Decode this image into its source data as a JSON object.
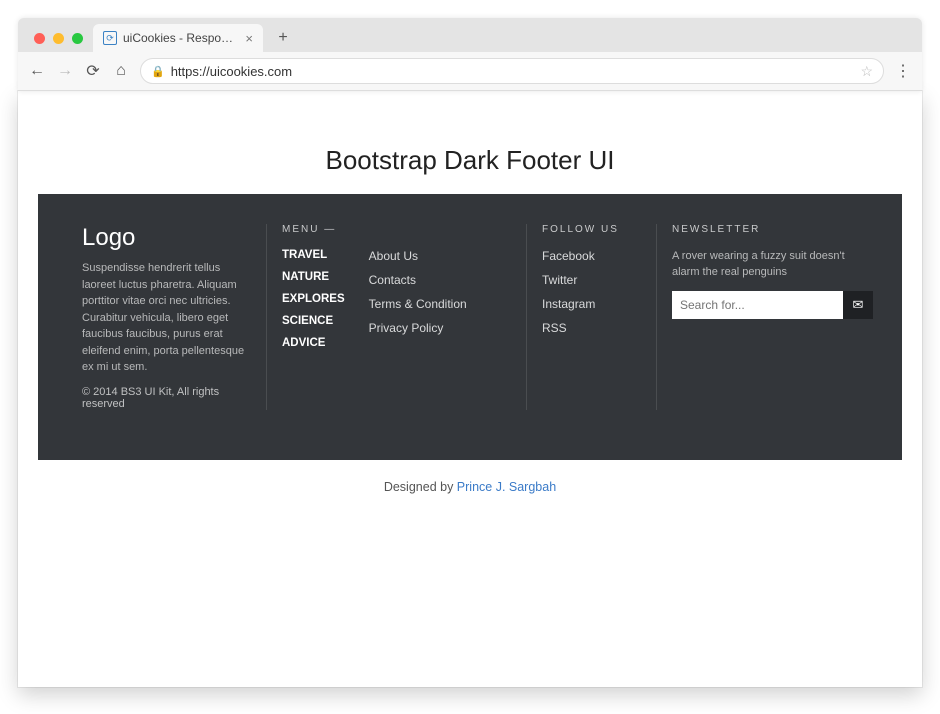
{
  "browser": {
    "tab_title": "uiCookies - Responsive HTML",
    "url": "https://uicookies.com"
  },
  "page": {
    "heading": "Bootstrap Dark Footer UI"
  },
  "footer": {
    "logo": {
      "title": "Logo",
      "description": "Suspendisse hendrerit tellus laoreet luctus pharetra. Aliquam porttitor vitae orci nec ultricies. Curabitur vehicula, libero eget faucibus faucibus, purus erat eleifend enim, porta pellentesque ex mi ut sem.",
      "copyright": "© 2014 BS3 UI Kit, All rights reserved"
    },
    "menu": {
      "heading": "MENU —",
      "primary": [
        "TRAVEL",
        "NATURE",
        "EXPLORES",
        "SCIENCE",
        "ADVICE"
      ],
      "secondary": [
        "About Us",
        "Contacts",
        "Terms & Condition",
        "Privacy Policy"
      ]
    },
    "follow": {
      "heading": "FOLLOW US",
      "items": [
        "Facebook",
        "Twitter",
        "Instagram",
        "RSS"
      ]
    },
    "newsletter": {
      "heading": "NEWSLETTER",
      "text": "A rover wearing a fuzzy suit doesn't alarm the real penguins",
      "placeholder": "Search for..."
    }
  },
  "credit": {
    "prefix": "Designed by ",
    "author": "Prince J. Sargbah"
  }
}
